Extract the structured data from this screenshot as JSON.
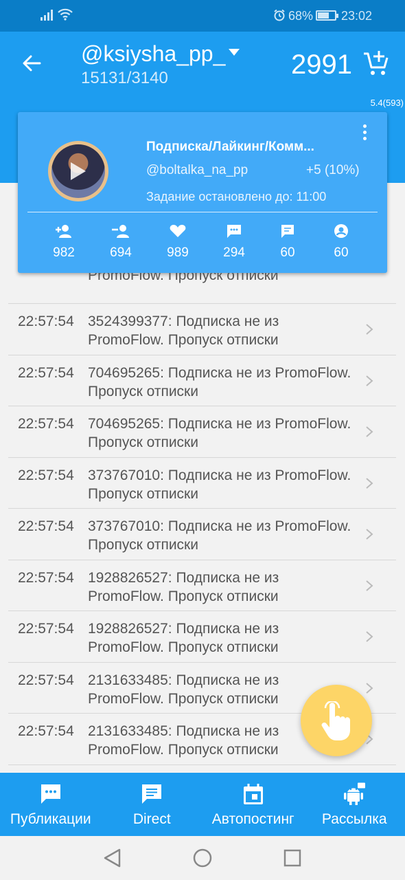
{
  "status_bar": {
    "battery_percent": "68%",
    "battery_level": 0.68,
    "time": "23:02",
    "icons": [
      "signal-icon",
      "wifi-icon",
      "alarm-icon",
      "battery-icon"
    ]
  },
  "app_bar": {
    "username": "@ksiysha_pp_",
    "counts": "15131/3140",
    "points": "2991",
    "icons": [
      "back-arrow-icon",
      "dropdown-icon",
      "cart-add-icon"
    ]
  },
  "version": "5.4(593)",
  "task_card": {
    "title": "Подписка/Лайкинг/Комм...",
    "target_user": "@boltalka_na_pp",
    "delta": "+5 (10%)",
    "status": "Задание остановлено до: 11:00",
    "stats": [
      {
        "icon": "follow-icon",
        "value": "982"
      },
      {
        "icon": "unfollow-icon",
        "value": "694"
      },
      {
        "icon": "heart-icon",
        "value": "989"
      },
      {
        "icon": "comment-icon",
        "value": "294"
      },
      {
        "icon": "direct-message-icon",
        "value": "60"
      },
      {
        "icon": "account-circle-icon",
        "value": "60"
      }
    ]
  },
  "log": {
    "partial_row": "PromoFlow. Пропуск отписки",
    "rows": [
      {
        "time": "22:57:54",
        "message": "3524399377: Подписка не из PromoFlow. Пропуск отписки"
      },
      {
        "time": "22:57:54",
        "message": "704695265: Подписка не из PromoFlow. Пропуск отписки"
      },
      {
        "time": "22:57:54",
        "message": "704695265: Подписка не из PromoFlow. Пропуск отписки"
      },
      {
        "time": "22:57:54",
        "message": "373767010: Подписка не из PromoFlow. Пропуск отписки"
      },
      {
        "time": "22:57:54",
        "message": "373767010: Подписка не из PromoFlow. Пропуск отписки"
      },
      {
        "time": "22:57:54",
        "message": "1928826527: Подписка не из PromoFlow. Пропуск отписки"
      },
      {
        "time": "22:57:54",
        "message": "1928826527: Подписка не из PromoFlow. Пропуск отписки"
      },
      {
        "time": "22:57:54",
        "message": "2131633485: Подписка не из PromoFlow. Пропуск отписки"
      },
      {
        "time": "22:57:54",
        "message": "2131633485: Подписка не из PromoFlow. Пропуск отписки"
      }
    ]
  },
  "fab": {
    "icon": "touch-hand-icon"
  },
  "bottom_nav": [
    {
      "label": "Публикации",
      "icon": "publications-icon"
    },
    {
      "label": "Direct",
      "icon": "direct-icon"
    },
    {
      "label": "Автопостинг",
      "icon": "calendar-icon"
    },
    {
      "label": "Рассылка",
      "icon": "android-bot-icon"
    }
  ],
  "colors": {
    "status_bar": "#0a7dc7",
    "app_bar": "#1d9df0",
    "card": "#42aaf8",
    "fab": "#fdd567",
    "background": "#f2f2f2"
  }
}
